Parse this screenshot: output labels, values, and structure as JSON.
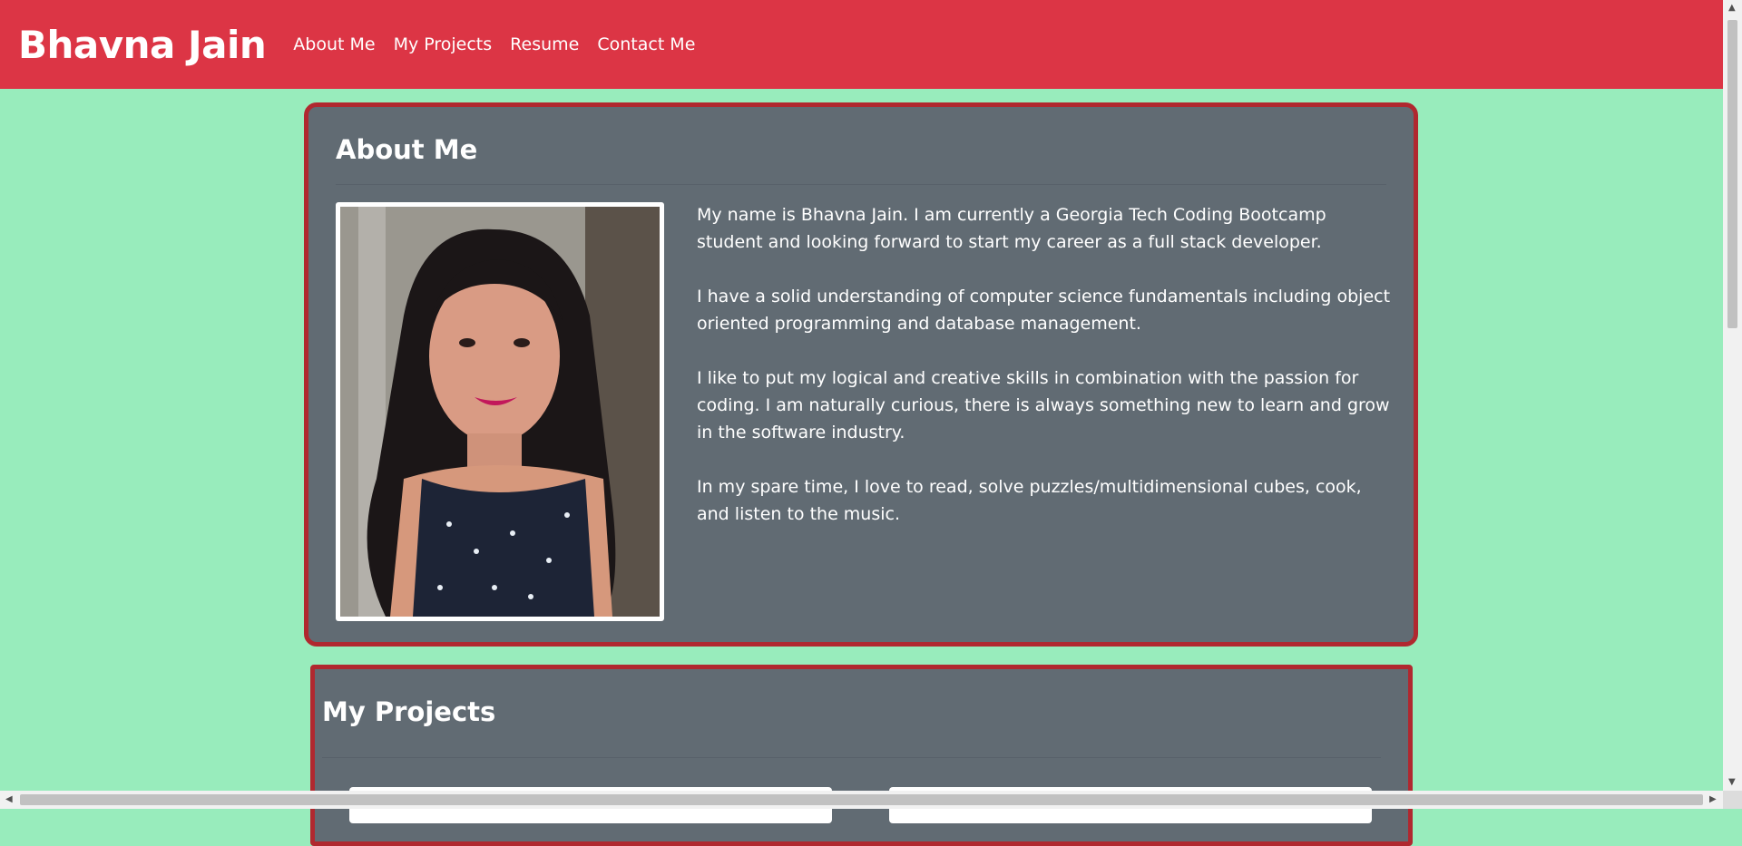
{
  "header": {
    "brand": "Bhavna Jain",
    "nav": [
      {
        "label": "About Me"
      },
      {
        "label": "My Projects"
      },
      {
        "label": "Resume"
      },
      {
        "label": "Contact Me"
      }
    ]
  },
  "about": {
    "title": "About Me",
    "paragraphs": [
      "My name is Bhavna Jain. I am currently a Georgia Tech Coding Bootcamp student and looking forward to start my career as a full stack developer.",
      "I have a solid understanding of computer science fundamentals including object oriented programming and database management.",
      "I like to put my logical and creative skills in combination with the passion for coding. I am naturally curious, there is always something new to learn and grow in the software industry.",
      "In my spare time, I love to read, solve puzzles/multidimensional cubes, cook, and listen to the music."
    ]
  },
  "projects": {
    "title": "My Projects"
  },
  "colors": {
    "page_bg": "#98ecbc",
    "navbar": "#dc3545",
    "card_bg": "#616b73",
    "card_border": "#b0282f"
  },
  "icons": {
    "scroll_up": "triangle-up",
    "scroll_down": "triangle-down",
    "scroll_left": "triangle-left",
    "scroll_right": "triangle-right"
  }
}
